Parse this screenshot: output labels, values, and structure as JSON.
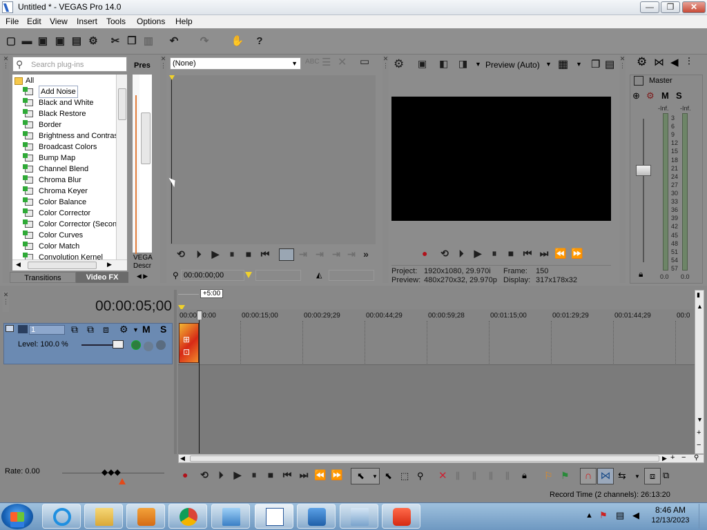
{
  "window": {
    "title": "Untitled * - VEGAS Pro 14.0",
    "min_glyph": "—",
    "max_glyph": "❐",
    "close_glyph": "✕"
  },
  "menu": [
    "File",
    "Edit",
    "View",
    "Insert",
    "Tools",
    "Options",
    "Help"
  ],
  "plugins": {
    "search_placeholder": "Search plug-ins",
    "root_label": "All",
    "items": [
      "Add Noise",
      "Black and White",
      "Black Restore",
      "Border",
      "Brightness and Contras",
      "Broadcast Colors",
      "Bump Map",
      "Channel Blend",
      "Chroma Blur",
      "Chroma Keyer",
      "Color Balance",
      "Color Corrector",
      "Color Corrector (Secon",
      "Color Curves",
      "Color Match",
      "Convolution Kernel"
    ],
    "selected_index": 0,
    "presets_label": "Pres",
    "side_text_1": "VEGA",
    "side_text_2": "Descr",
    "tab_transitions": "Transitions",
    "tab_videofx": "Video FX"
  },
  "trimmer": {
    "dropdown_value": "(None)",
    "timecode": "00:00:00;00"
  },
  "preview": {
    "mode_label": "Preview (Auto)",
    "project_label": "Project:",
    "project_value": "1920x1080, 29.970i",
    "preview_label": "Preview:",
    "preview_value": "480x270x32, 29.970p",
    "frame_label": "Frame:",
    "frame_value": "150",
    "display_label": "Display:",
    "display_value": "317x178x32"
  },
  "mixer": {
    "master_label": "Master",
    "m_label": "M",
    "s_label": "S",
    "inf_left": "-Inf.",
    "inf_right": "-Inf.",
    "scale": [
      "3",
      "6",
      "9",
      "12",
      "15",
      "18",
      "21",
      "24",
      "27",
      "30",
      "33",
      "36",
      "39",
      "42",
      "45",
      "48",
      "51",
      "54",
      "57"
    ],
    "bottom_left": "0.0",
    "bottom_right": "0.0",
    "level": 0.0
  },
  "timeline": {
    "cursor_time": "00:00:05;00",
    "zoom_label": "+5:00",
    "ruler_ticks": [
      "00:00:00:00",
      "00:00:15;00",
      "00:00:29;29",
      "00:00:44;29",
      "00:00:59;28",
      "00:01:15;00",
      "00:01:29;29",
      "00:01:44;29",
      "00:0"
    ],
    "track_number": "1",
    "track_m": "M",
    "track_s": "S",
    "level_label": "Level: 100.0 %",
    "rate_label": "Rate: 0.00",
    "record_time": "Record Time (2 channels): 26:13:20"
  },
  "taskbar": {
    "time": "8:46 AM",
    "date": "12/13/2023"
  },
  "colors": {
    "panel_bg": "#8d8d8d",
    "track_header": "#6b8ab2",
    "taskbar": "#7ea6cb"
  }
}
